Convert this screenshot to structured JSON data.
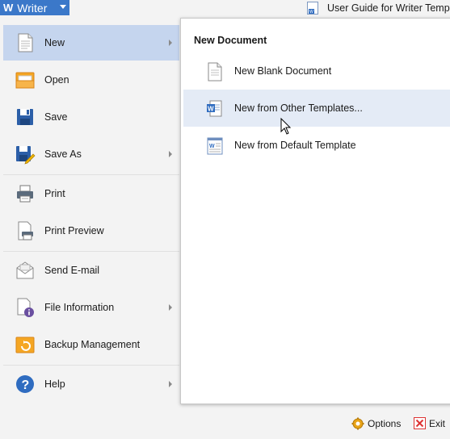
{
  "app": {
    "title": "Writer"
  },
  "tab": {
    "label": "User Guide for Writer Templates"
  },
  "menu": {
    "items": [
      {
        "label": "New"
      },
      {
        "label": "Open"
      },
      {
        "label": "Save"
      },
      {
        "label": "Save As"
      },
      {
        "label": "Print"
      },
      {
        "label": "Print Preview"
      },
      {
        "label": "Send E-mail"
      },
      {
        "label": "File Information"
      },
      {
        "label": "Backup Management"
      },
      {
        "label": "Help"
      }
    ]
  },
  "panel": {
    "title": "New Document",
    "items": [
      {
        "label": "New Blank Document"
      },
      {
        "label": "New from Other Templates..."
      },
      {
        "label": "New from Default Template"
      }
    ]
  },
  "footer": {
    "options_label": "Options",
    "exit_label": "Exit"
  },
  "colors": {
    "accent": "#3b78c9",
    "menu_active": "#c5d5ee",
    "panel_hover": "#e4ebf6"
  }
}
